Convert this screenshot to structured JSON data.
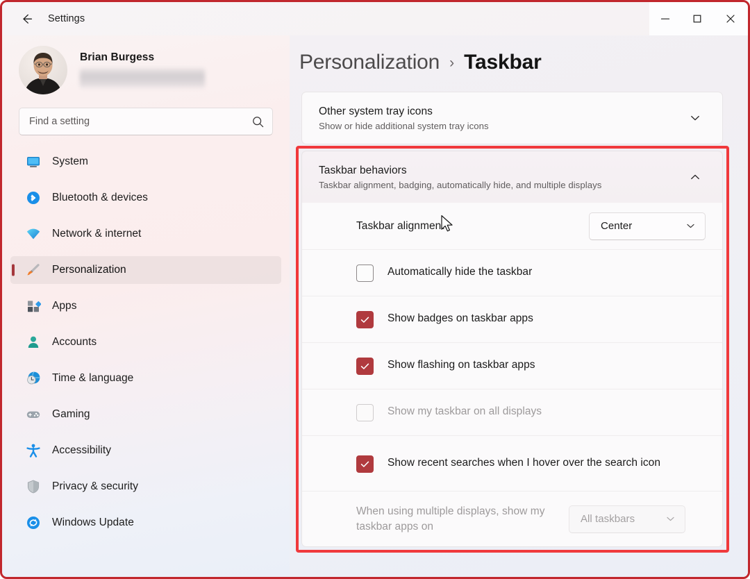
{
  "window": {
    "title": "Settings",
    "controls": {
      "minimize": "minimize",
      "maximize": "maximize",
      "close": "close"
    }
  },
  "sidebar": {
    "account": {
      "name": "Brian Burgess",
      "email_redacted": true
    },
    "search": {
      "placeholder": "Find a setting",
      "value": "",
      "icon": "search-icon"
    },
    "items": [
      {
        "label": "System",
        "icon": "monitor-icon",
        "selected": false
      },
      {
        "label": "Bluetooth & devices",
        "icon": "bluetooth-icon",
        "selected": false
      },
      {
        "label": "Network & internet",
        "icon": "wifi-icon",
        "selected": false
      },
      {
        "label": "Personalization",
        "icon": "paintbrush-icon",
        "selected": true
      },
      {
        "label": "Apps",
        "icon": "apps-icon",
        "selected": false
      },
      {
        "label": "Accounts",
        "icon": "person-icon",
        "selected": false
      },
      {
        "label": "Time & language",
        "icon": "clock-globe-icon",
        "selected": false
      },
      {
        "label": "Gaming",
        "icon": "gamepad-icon",
        "selected": false
      },
      {
        "label": "Accessibility",
        "icon": "accessibility-icon",
        "selected": false
      },
      {
        "label": "Privacy & security",
        "icon": "shield-icon",
        "selected": false
      },
      {
        "label": "Windows Update",
        "icon": "update-icon",
        "selected": false
      }
    ]
  },
  "main": {
    "breadcrumb": {
      "parent": "Personalization",
      "separator": "›",
      "current": "Taskbar"
    },
    "cards": [
      {
        "title": "Other system tray icons",
        "subtitle": "Show or hide additional system tray icons",
        "chevron": "chevron-down-icon",
        "expanded": false,
        "highlighted": false
      },
      {
        "title": "Taskbar behaviors",
        "subtitle": "Taskbar alignment, badging, automatically hide, and multiple displays",
        "chevron": "chevron-up-icon",
        "expanded": true,
        "highlighted": true
      }
    ],
    "behaviors_rows": [
      {
        "type": "dropdown",
        "label": "Taskbar alignment",
        "value": "Center",
        "chevron": "chevron-down-icon",
        "disabled": false
      },
      {
        "type": "checkbox",
        "label": "Automatically hide the taskbar",
        "checked": false,
        "disabled": false
      },
      {
        "type": "checkbox",
        "label": "Show badges on taskbar apps",
        "checked": true,
        "disabled": false
      },
      {
        "type": "checkbox",
        "label": "Show flashing on taskbar apps",
        "checked": true,
        "disabled": false
      },
      {
        "type": "checkbox",
        "label": "Show my taskbar on all displays",
        "checked": false,
        "disabled": true
      },
      {
        "type": "checkbox",
        "label": "Show recent searches when I hover over the search icon",
        "checked": true,
        "disabled": false
      },
      {
        "type": "dropdown",
        "label": "When using multiple displays, show my taskbar apps on",
        "value": "All taskbars",
        "chevron": "chevron-down-icon",
        "disabled": true
      }
    ]
  },
  "colors": {
    "accent_checkbox": "#b03a3e",
    "selection_bar": "#a4373c",
    "annotation_red": "#f0393c",
    "outer_frame_red": "#c1272d"
  },
  "cursor": {
    "type": "arrow-pointer"
  }
}
